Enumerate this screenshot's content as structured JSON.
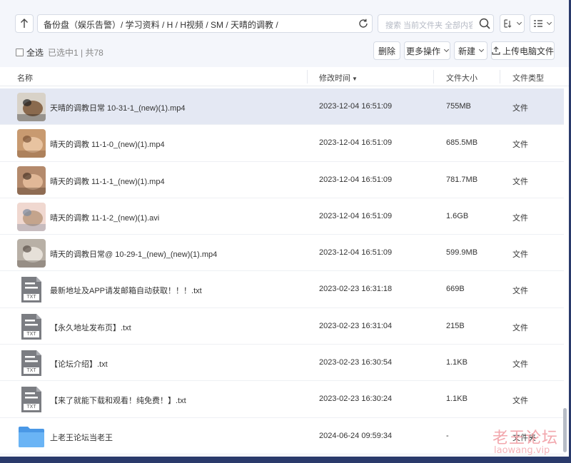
{
  "path": {
    "text": "备份盘（娱乐告警）/ 学习资料 / H / H视频 / SM / 天晴的调教 /"
  },
  "search": {
    "placeholder": "搜索 当前文件夹 全部内容"
  },
  "selection": {
    "select_all_label": "全选",
    "info": "已选中1 | 共78"
  },
  "actions": {
    "delete": "删除",
    "more": "更多操作",
    "new": "新建",
    "upload": "上传电脑文件"
  },
  "columns": {
    "name": "名称",
    "modified": "修改时间",
    "size": "文件大小",
    "type": "文件类型"
  },
  "files": [
    {
      "name": "天晴的调教日常 10-31-1_(new)(1).mp4",
      "modified": "2023-12-04 16:51:09",
      "size": "755MB",
      "type": "文件",
      "kind": "video",
      "selected": true
    },
    {
      "name": "晴天的调教 11-1-0_(new)(1).mp4",
      "modified": "2023-12-04 16:51:09",
      "size": "685.5MB",
      "type": "文件",
      "kind": "video"
    },
    {
      "name": "晴天的调教 11-1-1_(new)(1).mp4",
      "modified": "2023-12-04 16:51:09",
      "size": "781.7MB",
      "type": "文件",
      "kind": "video"
    },
    {
      "name": "晴天的调教 11-1-2_(new)(1).avi",
      "modified": "2023-12-04 16:51:09",
      "size": "1.6GB",
      "type": "文件",
      "kind": "video"
    },
    {
      "name": "晴天的调教日常@ 10-29-1_(new)_(new)(1).mp4",
      "modified": "2023-12-04 16:51:09",
      "size": "599.9MB",
      "type": "文件",
      "kind": "video"
    },
    {
      "name": "最新地址及APP请发邮箱自动获取！！！.txt",
      "modified": "2023-02-23 16:31:18",
      "size": "669B",
      "type": "文件",
      "kind": "txt",
      "badge": "TXT"
    },
    {
      "name": "【永久地址发布页】.txt",
      "modified": "2023-02-23 16:31:04",
      "size": "215B",
      "type": "文件",
      "kind": "txt",
      "badge": "TXT"
    },
    {
      "name": "【论坛介绍】.txt",
      "modified": "2023-02-23 16:30:54",
      "size": "1.1KB",
      "type": "文件",
      "kind": "txt",
      "badge": "TXT"
    },
    {
      "name": "【来了就能下载和观看！纯免费！】.txt",
      "modified": "2023-02-23 16:30:24",
      "size": "1.1KB",
      "type": "文件",
      "kind": "txt",
      "badge": "TXT"
    },
    {
      "name": "上老王论坛当老王",
      "modified": "2024-06-24 09:59:34",
      "size": "-",
      "type": "文件夹",
      "kind": "folder"
    }
  ],
  "watermark": {
    "cn": "老王论坛",
    "en": "laowang.vip"
  },
  "colors": {
    "selected_row": "#e4e8f3",
    "toolbar_bg": "#f4f6fb",
    "folder": "#5aa8ef"
  }
}
